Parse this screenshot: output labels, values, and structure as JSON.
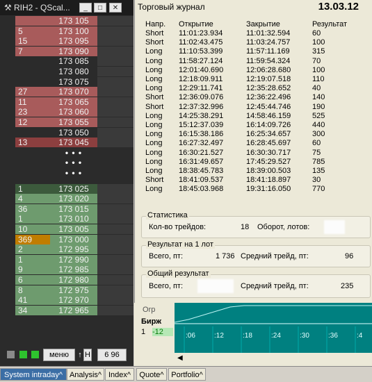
{
  "qscalp": {
    "title": "RIH2 - QScal...",
    "buttons": {
      "min": "_",
      "max": "□",
      "close": "✕"
    },
    "rows": [
      {
        "vol": "",
        "price": "173 105",
        "side": "ask"
      },
      {
        "vol": "5",
        "price": "173 100",
        "side": "ask"
      },
      {
        "vol": "15",
        "price": "173 095",
        "side": "ask"
      },
      {
        "vol": "7",
        "price": "173 090",
        "side": "ask"
      },
      {
        "vol": "",
        "price": "173 085",
        "side": "dim"
      },
      {
        "vol": "",
        "price": "173 080",
        "side": "dim"
      },
      {
        "vol": "",
        "price": "173 075",
        "side": "dim"
      },
      {
        "vol": "27",
        "price": "173 070",
        "side": "ask"
      },
      {
        "vol": "11",
        "price": "173 065",
        "side": "ask"
      },
      {
        "vol": "23",
        "price": "173 060",
        "side": "ask"
      },
      {
        "vol": "12",
        "price": "173 055",
        "side": "ask"
      },
      {
        "vol": "",
        "price": "173 050",
        "side": "dim"
      },
      {
        "vol": "13",
        "price": "173 045",
        "side": "ask2"
      }
    ],
    "dots": [
      "• • •",
      "• • •",
      "• • •"
    ],
    "bids": [
      {
        "vol": "1",
        "price": "173 025",
        "side": "bidtop"
      },
      {
        "vol": "4",
        "price": "173 020",
        "side": "bid"
      },
      {
        "vol": "36",
        "price": "173 015",
        "side": "bid"
      },
      {
        "vol": "1",
        "price": "173 010",
        "side": "bid"
      },
      {
        "vol": "10",
        "price": "173 005",
        "side": "bid"
      },
      {
        "vol": "369",
        "price": "173 000",
        "side": "bidhl"
      },
      {
        "vol": "2",
        "price": "172 995",
        "side": "bid"
      },
      {
        "vol": "1",
        "price": "172 990",
        "side": "bid"
      },
      {
        "vol": "9",
        "price": "172 985",
        "side": "bid"
      },
      {
        "vol": "6",
        "price": "172 980",
        "side": "bid"
      },
      {
        "vol": "8",
        "price": "172 975",
        "side": "bid"
      },
      {
        "vol": "41",
        "price": "172 970",
        "side": "bid"
      },
      {
        "vol": "34",
        "price": "172 965",
        "side": "bid"
      }
    ],
    "menu_label": "меню",
    "arrow_label": "↑",
    "h_label": "H",
    "value_label": "6 96"
  },
  "journal": {
    "title": "Торговый журнал",
    "date": "13.03.12",
    "headers": [
      "Напр.",
      "Открытие",
      "Закрытие",
      "Результат"
    ],
    "trades": [
      [
        "Short",
        "11:01:23.934",
        "11:01:32.594",
        "60"
      ],
      [
        "Short",
        "11:02:43.475",
        "11:03:24.757",
        "100"
      ],
      [
        "Long",
        "11:10:53.399",
        "11:57:11.169",
        "315"
      ],
      [
        "Long",
        "11:58:27.124",
        "11:59:54.324",
        "70"
      ],
      [
        "Long",
        "12:01:40.690",
        "12:06:28.680",
        "100"
      ],
      [
        "Long",
        "12:18:09.911",
        "12:19:07.518",
        "110"
      ],
      [
        "Long",
        "12:29:11.741",
        "12:35:28.652",
        "40"
      ],
      [
        "Short",
        "12:36:09.076",
        "12:36:22.496",
        "140"
      ],
      [
        "Short",
        "12:37:32.996",
        "12:45:44.746",
        "190"
      ],
      [
        "Long",
        "14:25:38.291",
        "14:58:46.159",
        "525"
      ],
      [
        "Long",
        "15:12:37.039",
        "16:14:09.726",
        "440"
      ],
      [
        "Long",
        "16:15:38.186",
        "16:25:34.657",
        "300"
      ],
      [
        "Long",
        "16:27:32.497",
        "16:28:45.697",
        "60"
      ],
      [
        "Long",
        "16:30:21.527",
        "16:30:30.717",
        "75"
      ],
      [
        "Long",
        "16:31:49.657",
        "17:45:29.527",
        "785"
      ],
      [
        "Long",
        "18:38:45.783",
        "18:39:00.503",
        "135"
      ],
      [
        "Short",
        "18:41:09.537",
        "18:41:18.897",
        "30"
      ],
      [
        "Long",
        "18:45:03.968",
        "19:31:16.050",
        "770"
      ]
    ],
    "stats": {
      "caption": "Статистика",
      "trades_label": "Кол-во трейдов:",
      "trades_value": "18",
      "turnover_label": "Оборот, лотов:"
    },
    "per_lot": {
      "caption": "Результат на 1 лот",
      "total_label": "Всего, пт:",
      "total_value": "1 736",
      "avg_label": "Средний трейд, пт:",
      "avg_value": "96"
    },
    "overall": {
      "caption": "Общий результат",
      "total_label": "Всего, пт:",
      "avg_label": "Средний трейд, пт:",
      "avg_value": "235"
    }
  },
  "mini": {
    "tab_label": "Orp",
    "col_label": "Бирж",
    "row_label": "1",
    "row_value": "-12",
    "ticks": [
      ":06",
      ":12",
      ":18",
      ":24",
      ":30",
      ":36",
      ":4"
    ]
  },
  "taskbar": {
    "tabs": [
      "System intraday^",
      "Analysis^",
      "Index^",
      "Quote^",
      "Portfolio^"
    ]
  },
  "colors": {
    "ask": "#a85b5b",
    "bid": "#6e9b6e",
    "highlight": "#c07d00",
    "chart": "#008080",
    "active_tab": "#3b6ea5"
  }
}
